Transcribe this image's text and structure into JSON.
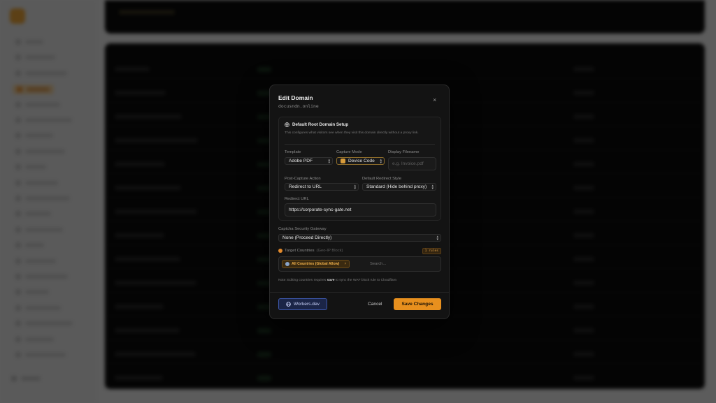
{
  "background": {
    "app_name": "",
    "sidebar_items": 21
  },
  "modal": {
    "title": "Edit Domain",
    "domain": "docusndn.online",
    "close_label": "×",
    "setup": {
      "heading": "Default Root Domain Setup",
      "description": "This configures what visitors see when they visit this domain directly without a proxy link."
    },
    "template": {
      "label": "Template",
      "value": "Adobe PDF"
    },
    "capture_mode": {
      "label": "Capture Mode",
      "value": "Device Code"
    },
    "display_filename": {
      "label": "Display Filename",
      "placeholder": "e.g. Invoice.pdf"
    },
    "post_capture": {
      "label": "Post-Capture Action",
      "value": "Redirect to URL"
    },
    "redirect_style": {
      "label": "Default Redirect Style",
      "value": "Standard (Hide behind proxy)"
    },
    "redirect_url": {
      "label": "Redirect URL",
      "value": "https://corporate-sync-gate.net"
    },
    "captcha": {
      "label": "Captcha Security Gateway",
      "value": "None (Proceed Directly)"
    },
    "countries": {
      "label": "Target Countries",
      "hint": "(Geo-IP Block)",
      "rules_badge": "1 rules",
      "chip_label": "All Countries (Global Allow)",
      "chip_remove": "×",
      "search_placeholder": "Search..."
    },
    "note": {
      "prefix": "Note: Editing countries requires ",
      "bold": "save",
      "suffix": " to sync the WAF block rule to Cloudflare."
    },
    "buttons": {
      "workers": "Workers.dev",
      "cancel": "Cancel",
      "save": "Save Changes"
    }
  },
  "colors": {
    "accent": "#e8901e",
    "workers_blue": "#3c56a8",
    "modal_bg": "#131313"
  }
}
